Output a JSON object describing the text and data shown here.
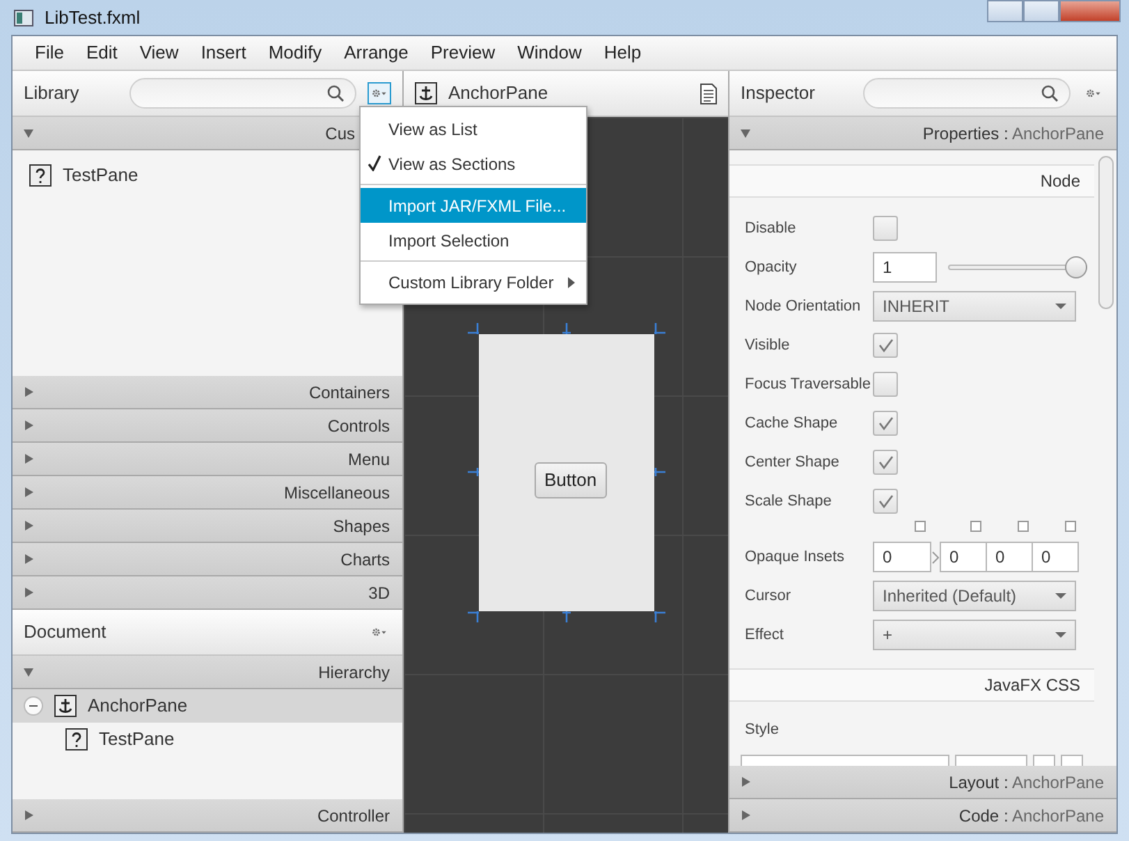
{
  "window": {
    "title": "LibTest.fxml"
  },
  "menu_bar": [
    {
      "label": "File"
    },
    {
      "label": "Edit"
    },
    {
      "label": "View"
    },
    {
      "label": "Insert"
    },
    {
      "label": "Modify"
    },
    {
      "label": "Arrange"
    },
    {
      "label": "Preview"
    },
    {
      "label": "Window"
    },
    {
      "label": "Help"
    }
  ],
  "library": {
    "title": "Library",
    "sections": [
      {
        "label": "Cus",
        "expanded": true,
        "items": [
          {
            "label": "TestPane"
          }
        ]
      },
      {
        "label": "Containers",
        "expanded": false
      },
      {
        "label": "Controls",
        "expanded": false
      },
      {
        "label": "Menu",
        "expanded": false
      },
      {
        "label": "Miscellaneous",
        "expanded": false
      },
      {
        "label": "Shapes",
        "expanded": false
      },
      {
        "label": "Charts",
        "expanded": false
      },
      {
        "label": "3D",
        "expanded": false
      }
    ]
  },
  "library_menu": {
    "items": [
      {
        "kind": "item",
        "label": "View as List",
        "checked": false,
        "selected": false
      },
      {
        "kind": "item",
        "label": "View as Sections",
        "checked": true,
        "selected": false
      },
      {
        "kind": "separator"
      },
      {
        "kind": "item",
        "label": "Import JAR/FXML File...",
        "checked": false,
        "selected": true
      },
      {
        "kind": "item",
        "label": "Import Selection",
        "checked": false,
        "selected": false
      },
      {
        "kind": "separator"
      },
      {
        "kind": "submenu",
        "label": "Custom Library Folder",
        "checked": false,
        "selected": false
      }
    ]
  },
  "center": {
    "title": "AnchorPane",
    "button": "Button"
  },
  "document": {
    "title": "Document",
    "sections": [
      {
        "label": "Hierarchy",
        "expanded": true,
        "tree": [
          {
            "label": "AnchorPane",
            "selected": true,
            "expanded": true,
            "children": [
              {
                "label": "TestPane",
                "selected": false
              }
            ]
          }
        ]
      },
      {
        "label": "Controller",
        "expanded": false
      }
    ]
  },
  "inspector": {
    "title": "Inspector",
    "sections": [
      {
        "title": "Properties :",
        "subject": "AnchorPane",
        "expanded": true,
        "groups": [
          {
            "title": "Node",
            "rows": [
              {
                "kind": "checkbox",
                "label": "Disable",
                "checked": false
              },
              {
                "kind": "slider",
                "label": "Opacity",
                "value": "1",
                "level": 1
              },
              {
                "kind": "select",
                "label": "Node Orientation",
                "value": "INHERIT"
              },
              {
                "kind": "checkbox",
                "label": "Visible",
                "checked": true
              },
              {
                "kind": "checkbox",
                "label": "Focus Traversable",
                "checked": false
              },
              {
                "kind": "checkbox",
                "label": "Cache Shape",
                "checked": true
              },
              {
                "kind": "checkbox",
                "label": "Center Shape",
                "checked": true
              },
              {
                "kind": "checkbox",
                "label": "Scale Shape",
                "checked": true
              },
              {
                "kind": "insets",
                "label": "Opaque Insets",
                "values": [
                  "0",
                  "0",
                  "0",
                  "0"
                ],
                "links": [
                  false,
                  false,
                  false,
                  false
                ]
              },
              {
                "kind": "select",
                "label": "Cursor",
                "value": "Inherited (Default)"
              },
              {
                "kind": "select",
                "label": "Effect",
                "value": "+"
              }
            ]
          },
          {
            "title": "JavaFX CSS",
            "rows": [
              {
                "kind": "style",
                "label": "Style"
              }
            ]
          }
        ]
      },
      {
        "title": "Layout :",
        "subject": "AnchorPane",
        "expanded": false
      },
      {
        "title": "Code :",
        "subject": "AnchorPane",
        "expanded": false
      }
    ]
  }
}
